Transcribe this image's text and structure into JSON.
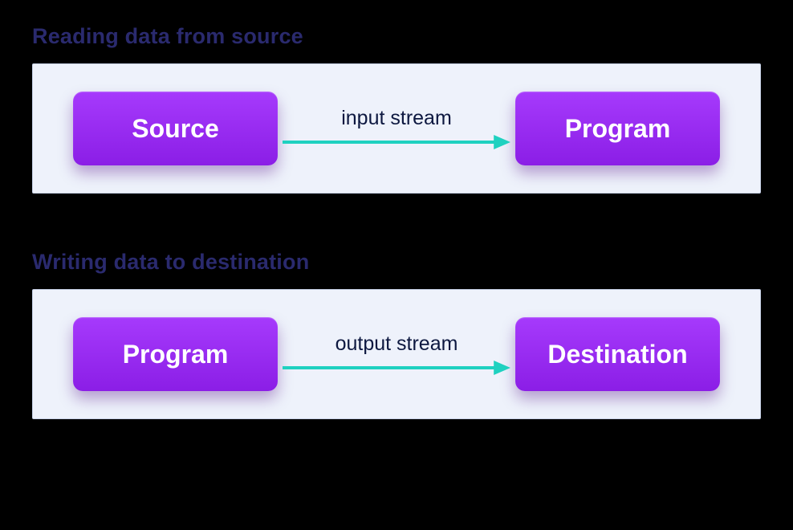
{
  "sections": {
    "reading": {
      "title": "Reading data from source",
      "left_node": "Source",
      "arrow_label": "input stream",
      "right_node": "Program"
    },
    "writing": {
      "title": "Writing data to destination",
      "left_node": "Program",
      "arrow_label": "output stream",
      "right_node": "Destination"
    }
  },
  "colors": {
    "node_gradient_top": "#a63afc",
    "node_gradient_bottom": "#8b1ee6",
    "arrow": "#1fd1c0",
    "panel_bg": "#eef2fb",
    "title": "#2a2a6e",
    "background": "#000000"
  }
}
